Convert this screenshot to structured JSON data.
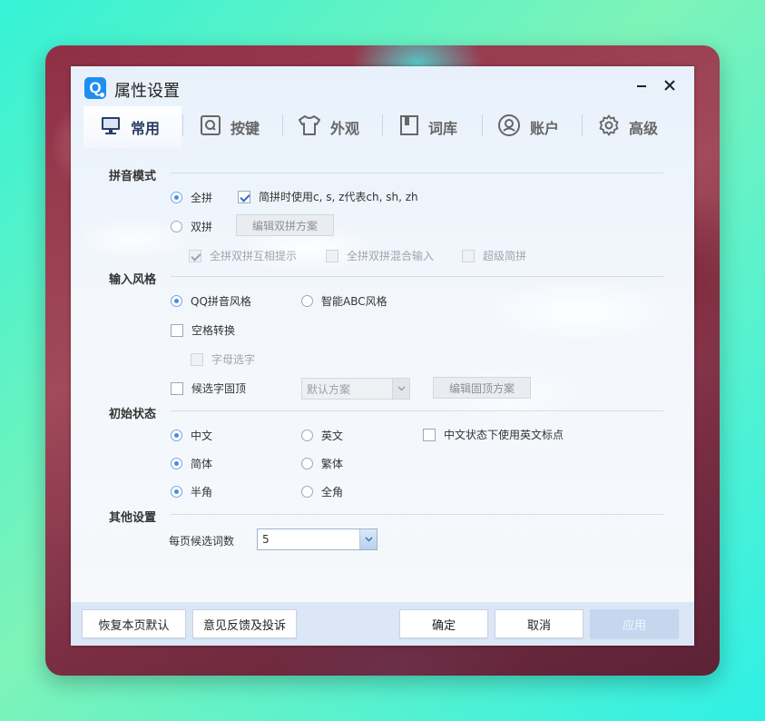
{
  "window": {
    "title": "属性设置",
    "logo_letter": "Q",
    "minimize_glyph": "—",
    "close_glyph": "✕"
  },
  "tabs": [
    {
      "label": "常用",
      "icon": "monitor-icon",
      "active": true
    },
    {
      "label": "按键",
      "icon": "q-key-icon",
      "active": false
    },
    {
      "label": "外观",
      "icon": "shirt-icon",
      "active": false
    },
    {
      "label": "词库",
      "icon": "book-icon",
      "active": false
    },
    {
      "label": "账户",
      "icon": "account-icon",
      "active": false
    },
    {
      "label": "高级",
      "icon": "gear-icon",
      "active": false
    }
  ],
  "pinyin_mode": {
    "title": "拼音模式",
    "full": {
      "label": "全拼",
      "selected": true
    },
    "simplify_check": {
      "label": "简拼时使用c, s, z代表ch, sh, zh",
      "checked": true
    },
    "double": {
      "label": "双拼",
      "selected": false
    },
    "edit_double_button": "编辑双拼方案",
    "hint_check": {
      "label": "全拼双拼互相提示",
      "checked": true,
      "disabled": true
    },
    "mixed_check": {
      "label": "全拼双拼混合输入",
      "checked": false,
      "disabled": true
    },
    "super_check": {
      "label": "超级简拼",
      "checked": false,
      "disabled": true
    }
  },
  "input_style": {
    "title": "输入风格",
    "qq_style": {
      "label": "QQ拼音风格",
      "selected": true
    },
    "abc_style": {
      "label": "智能ABC风格",
      "selected": false
    },
    "space_convert": {
      "label": "空格转换",
      "checked": false
    },
    "letter_select": {
      "label": "字母选字",
      "checked": false,
      "disabled": true
    },
    "fixed_top": {
      "label": "候选字固顶",
      "checked": false
    },
    "scheme_select": {
      "value": "默认方案"
    },
    "edit_fixed_button": "编辑固顶方案"
  },
  "initial_state": {
    "title": "初始状态",
    "chinese": {
      "label": "中文",
      "selected": true
    },
    "english": {
      "label": "英文",
      "selected": false
    },
    "cn_punct": {
      "label": "中文状态下使用英文标点",
      "checked": false
    },
    "simplified": {
      "label": "简体",
      "selected": true
    },
    "traditional": {
      "label": "繁体",
      "selected": false
    },
    "half_width": {
      "label": "半角",
      "selected": true
    },
    "full_width": {
      "label": "全角",
      "selected": false
    }
  },
  "other": {
    "title": "其他设置",
    "per_page_label": "每页候选词数",
    "per_page_value": "5"
  },
  "footer": {
    "restore_default": "恢复本页默认",
    "feedback": "意见反馈及投诉",
    "ok": "确定",
    "cancel": "取消",
    "apply": "应用"
  },
  "colors": {
    "accent": "#4b8ee0",
    "logo": "#1e8ff0",
    "footer_bg": "#dbe7f6",
    "apply_disabled": "#c5d6ee"
  }
}
